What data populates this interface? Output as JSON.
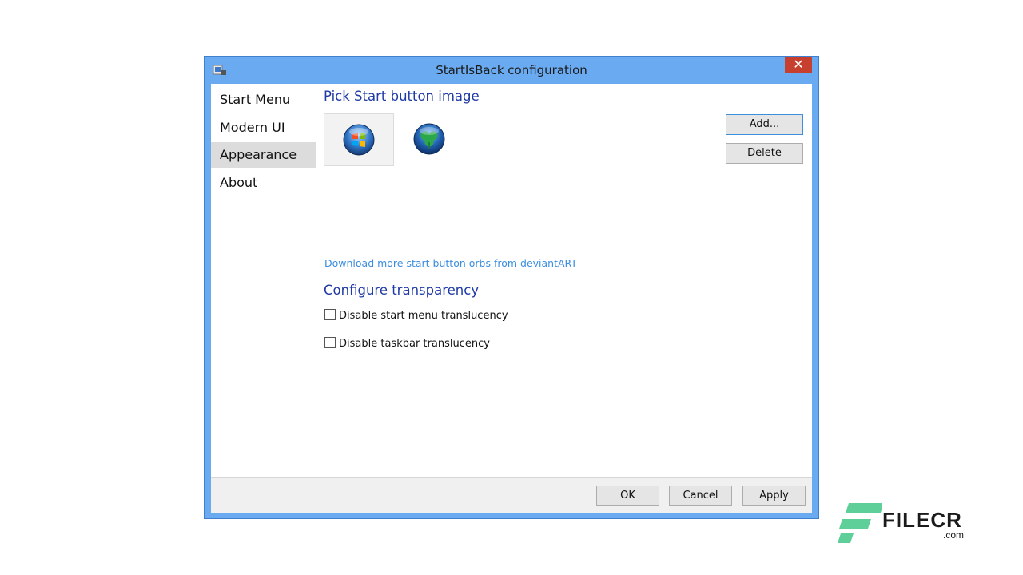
{
  "window": {
    "title": "StartIsBack configuration",
    "close_symbol": "✕"
  },
  "sidebar": {
    "items": [
      {
        "label": "Start Menu"
      },
      {
        "label": "Modern UI"
      },
      {
        "label": "Appearance",
        "selected": true
      },
      {
        "label": "About"
      }
    ]
  },
  "appearance": {
    "pick_title": "Pick Start button image",
    "orbs": [
      {
        "icon": "windows-orb-icon",
        "selected": true
      },
      {
        "icon": "shamrock-orb-icon",
        "selected": false
      }
    ],
    "add_label": "Add...",
    "delete_label": "Delete",
    "download_link": "Download more start button orbs from deviantART",
    "transparency_title": "Configure transparency",
    "checkboxes": [
      {
        "label": "Disable start menu translucency",
        "checked": false
      },
      {
        "label": "Disable taskbar translucency",
        "checked": false
      }
    ]
  },
  "footer": {
    "ok_label": "OK",
    "cancel_label": "Cancel",
    "apply_label": "Apply"
  },
  "watermark": {
    "brand": "FILECR",
    "domain": ".com"
  },
  "colors": {
    "window_frame": "#6aaaf0",
    "close_button": "#c7402f",
    "section_title": "#1f3aa5",
    "link": "#3c8ee0",
    "watermark_green": "#5fcf9a"
  }
}
